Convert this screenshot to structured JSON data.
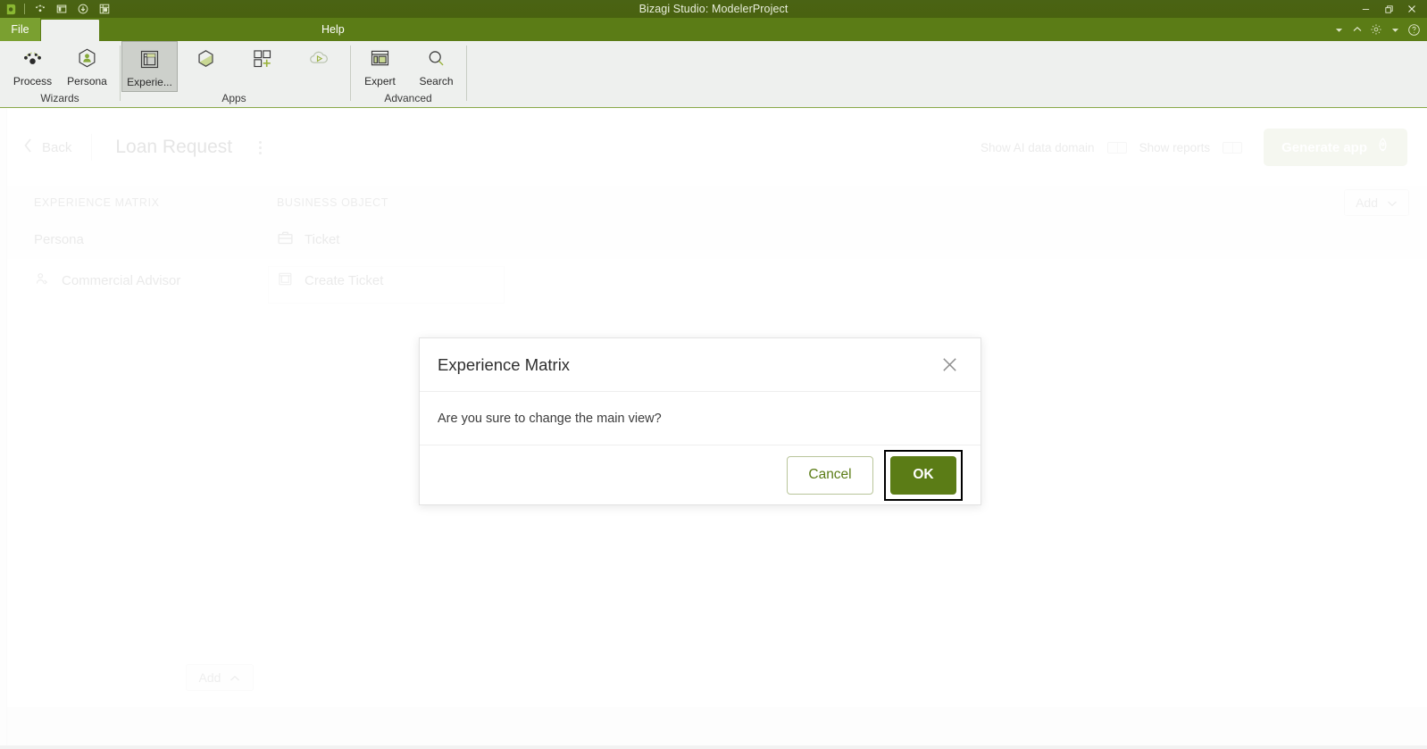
{
  "window": {
    "title": "Bizagi Studio: ModelerProject",
    "quick_access": [
      {
        "name": "bizagi-logo-icon",
        "label": "Bizagi"
      },
      {
        "name": "network-icon",
        "label": "Network"
      },
      {
        "name": "window-icon",
        "label": "Window"
      },
      {
        "name": "download-icon",
        "label": "Download"
      },
      {
        "name": "grid-icon",
        "label": "Grid"
      }
    ],
    "controls": [
      {
        "name": "minimize-button",
        "glyph": "─"
      },
      {
        "name": "restore-button",
        "glyph": "❐"
      },
      {
        "name": "close-button",
        "glyph": "✕"
      }
    ]
  },
  "ribbon": {
    "tabs": {
      "file": "File",
      "active": "",
      "help": "Help"
    },
    "controls": [
      {
        "name": "ribbon-dropdown-button",
        "glyph": "▾"
      },
      {
        "name": "ribbon-collapse-button",
        "glyph": "⌃"
      },
      {
        "name": "ribbon-settings-icon",
        "glyph": "⚙"
      },
      {
        "name": "ribbon-settings-dropdown-button",
        "glyph": "▾"
      },
      {
        "name": "help-circle-icon",
        "glyph": "?"
      }
    ],
    "groups": [
      {
        "label": "Wizards",
        "items": [
          {
            "label": "Process",
            "icon": "process-icon",
            "selected": false
          },
          {
            "label": "Persona",
            "icon": "persona-icon",
            "selected": false
          }
        ]
      },
      {
        "label": "Apps",
        "items": [
          {
            "label": "Experie...",
            "icon": "experience-matrix-icon",
            "selected": true
          },
          {
            "label": "",
            "icon": "hexagon-icon",
            "selected": false
          },
          {
            "label": "",
            "icon": "add-app-icon",
            "selected": false
          },
          {
            "label": "",
            "icon": "cloud-play-icon",
            "selected": false
          }
        ]
      },
      {
        "label": "Advanced",
        "items": [
          {
            "label": "Expert",
            "icon": "expert-icon",
            "selected": false
          },
          {
            "label": "Search",
            "icon": "search-icon",
            "selected": false
          }
        ]
      }
    ]
  },
  "page": {
    "back_label": "Back",
    "title": "Loan Request",
    "toggles": [
      {
        "label": "Show AI data domain",
        "name": "show-ai-data-domain-toggle",
        "on": false
      },
      {
        "label": "Show reports",
        "name": "show-reports-toggle",
        "on": false
      }
    ],
    "generate_button": "Generate app",
    "columns": {
      "experience_matrix": "EXPERIENCE MATRIX",
      "business_object": "BUSINESS OBJECT"
    },
    "add_dropdown": "Add",
    "rows": [
      {
        "persona": "Persona",
        "business_object": "Ticket",
        "bo_icon": "briefcase-icon"
      },
      {
        "persona": "Commercial Advisor",
        "persona_icon": "user-arrow-icon",
        "business_object": "Create Ticket",
        "bo_icon": "form-icon"
      }
    ],
    "bottom_add": "Add"
  },
  "modal": {
    "title": "Experience Matrix",
    "message": "Are you sure to change the main view?",
    "close_label": "✕",
    "cancel_label": "Cancel",
    "ok_label": "OK"
  },
  "colors": {
    "titlebar": "#4a6314",
    "tabstrip": "#5b7c16",
    "accent_green": "#5b7c16",
    "generate_button": "#c5d0a6",
    "ribbon_bg": "#eef0ee"
  }
}
